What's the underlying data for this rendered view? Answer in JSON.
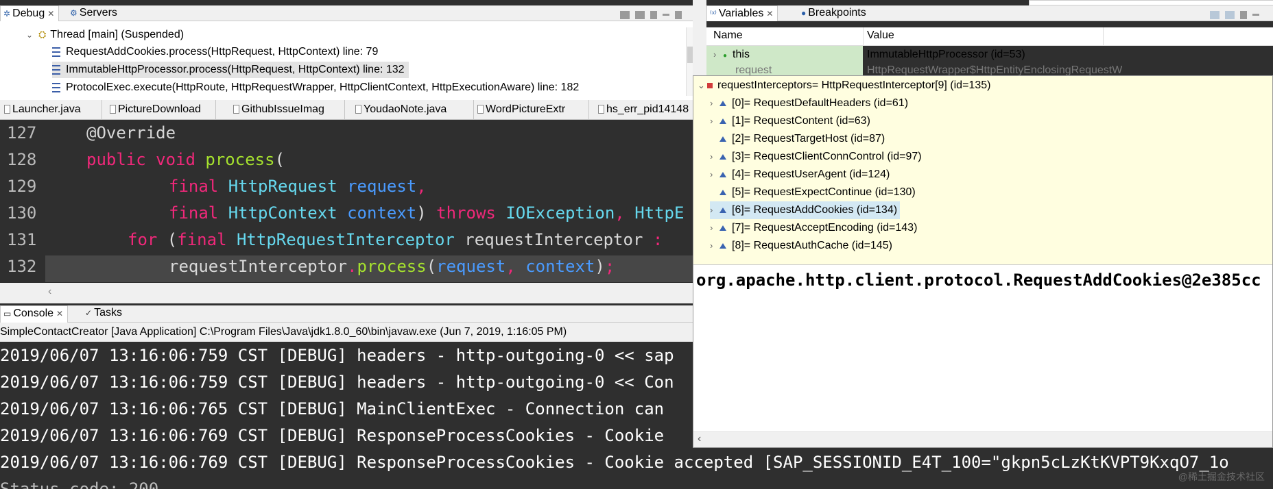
{
  "debug_view": {
    "tabs": [
      {
        "label": "Debug",
        "close": "✕"
      },
      {
        "label": "Servers"
      }
    ],
    "thread": "Thread [main] (Suspended)",
    "frames": [
      "RequestAddCookies.process(HttpRequest, HttpContext) line: 79",
      "ImmutableHttpProcessor.process(HttpRequest, HttpContext) line: 132",
      "ProtocolExec.execute(HttpRoute, HttpRequestWrapper, HttpClientContext, HttpExecutionAware) line: 182"
    ]
  },
  "variables_view": {
    "tabs": [
      {
        "label": "Variables",
        "close": "✕"
      },
      {
        "label": "Breakpoints"
      }
    ],
    "columns": [
      "Name",
      "Value"
    ],
    "rows": [
      {
        "name": "this",
        "value": "ImmutableHttpProcessor  (id=53)"
      },
      {
        "name": "request",
        "value": "HttpRequestWrapper$HttpEntityEnclosingRequestW"
      }
    ]
  },
  "editor": {
    "tabs": [
      "Launcher.java",
      "PictureDownload",
      "GithubIssueImag",
      "YoudaoNote.java",
      "WordPictureExtr",
      "hs_err_pid14148"
    ],
    "line_numbers": [
      "127",
      "128",
      "129",
      "130",
      "131",
      "132"
    ]
  },
  "console_view": {
    "tabs": [
      "Console",
      "Tasks"
    ],
    "description": "SimpleContactCreator [Java Application] C:\\Program Files\\Java\\jdk1.8.0_60\\bin\\javaw.exe (Jun 7, 2019, 1:16:05 PM)",
    "lines": [
      "2019/06/07 13:16:06:759 CST [DEBUG] headers - http-outgoing-0 << sap",
      "2019/06/07 13:16:06:759 CST [DEBUG] headers - http-outgoing-0 << Con",
      "2019/06/07 13:16:06:765 CST [DEBUG] MainClientExec - Connection can",
      "2019/06/07 13:16:06:769 CST [DEBUG] ResponseProcessCookies - Cookie",
      "2019/06/07 13:16:06:769 CST [DEBUG] ResponseProcessCookies - Cookie accepted [SAP_SESSIONID_E4T_100=\"gkpn5cLzKtKVPT9KxqO7_1o",
      "Status code: 200"
    ]
  },
  "inspect_popup": {
    "root": "requestInterceptors= HttpRequestInterceptor[9]  (id=135)",
    "items": [
      {
        "label": "[0]= RequestDefaultHeaders  (id=61)",
        "expandable": true
      },
      {
        "label": "[1]= RequestContent  (id=63)",
        "expandable": true
      },
      {
        "label": "[2]= RequestTargetHost  (id=87)",
        "expandable": false
      },
      {
        "label": "[3]= RequestClientConnControl  (id=97)",
        "expandable": true
      },
      {
        "label": "[4]= RequestUserAgent  (id=124)",
        "expandable": true
      },
      {
        "label": "[5]= RequestExpectContinue  (id=130)",
        "expandable": false
      },
      {
        "label": "[6]= RequestAddCookies  (id=134)",
        "expandable": true,
        "selected": true
      },
      {
        "label": "[7]= RequestAcceptEncoding  (id=143)",
        "expandable": true
      },
      {
        "label": "[8]= RequestAuthCache  (id=145)",
        "expandable": true
      }
    ],
    "detail": "org.apache.http.client.protocol.RequestAddCookies@2e385cc"
  },
  "watermark": "@稀土掘金技术社区",
  "colors": {
    "editor_bg": "#2f2f2f",
    "keyword": "#f0287a",
    "type": "#66d9ef",
    "method": "#a6e22e",
    "param": "#4a9bff",
    "popup_bg": "#fffee0",
    "selection": "#d3e8f3"
  },
  "icons": {
    "debug_tab": "debug-bug-icon",
    "thread": "thread-icon",
    "stack_frame": "stack-frame-icon",
    "inspect_item": "field-triangle-icon"
  }
}
